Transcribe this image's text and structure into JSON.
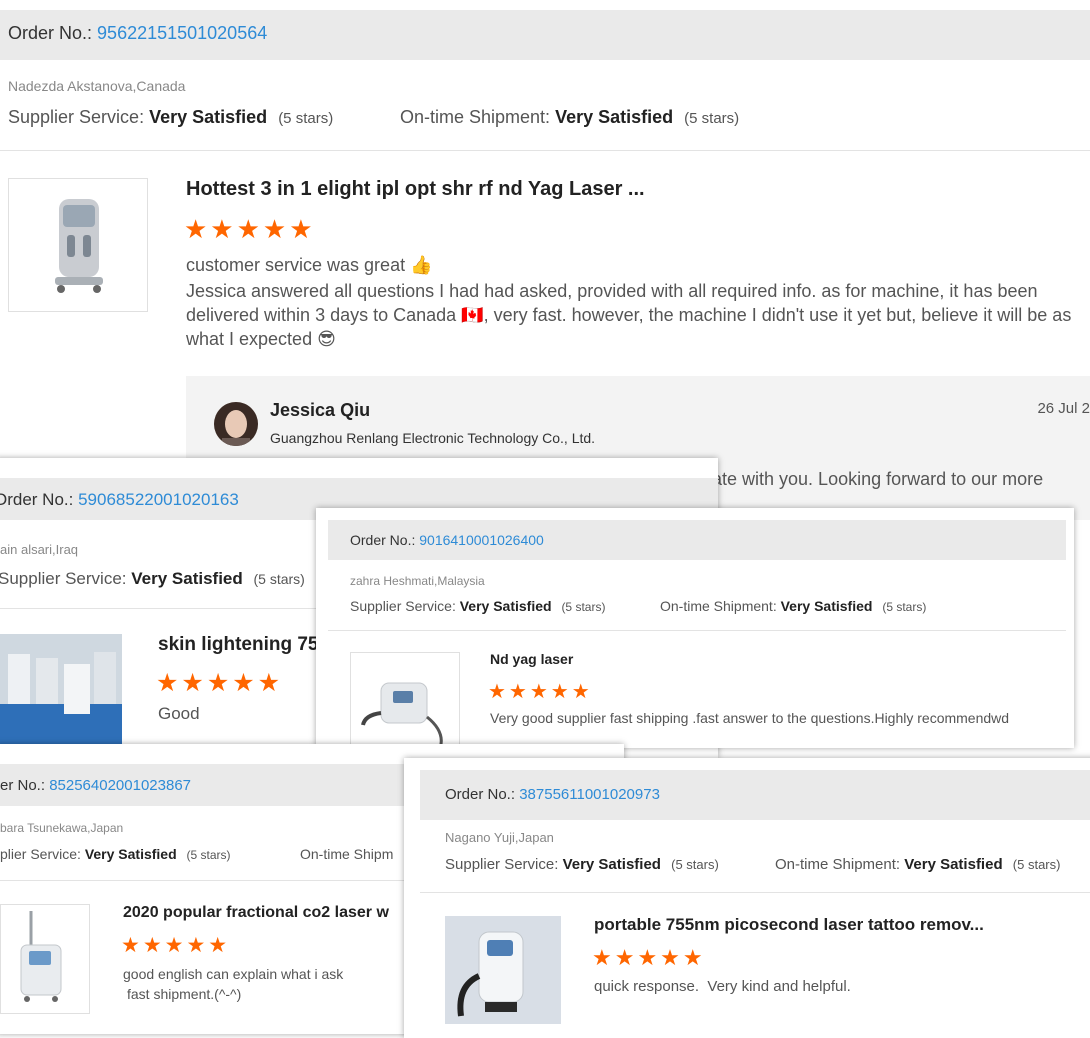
{
  "review1": {
    "order_label": "Order No.:",
    "order_no": "95622151501020564",
    "buyer": "Nadezda Akstanova,Canada",
    "supplier_service_label": "Supplier Service:",
    "supplier_service_value": "Very Satisfied",
    "supplier_service_stars": "(5 stars)",
    "shipment_label": "On-time Shipment:",
    "shipment_value": "Very Satisfied",
    "shipment_stars": "(5 stars)",
    "product_title": "Hottest 3 in 1 elight ipl opt shr rf nd Yag Laser ...",
    "rating_stars": "★★★★★",
    "review_line1": "customer service was great 👍",
    "review_line2": "Jessica answered all questions I had had asked, provided with all required info. as for machine, it has been delivered within 3 days to Canada 🇨🇦, very fast. however, the machine I didn't use it yet but, believe it will be as what I expected 😎",
    "reply_name": "Jessica Qiu",
    "reply_company": "Guangzhou Renlang Electronic Technology Co., Ltd.",
    "reply_date": "26 Jul 2",
    "reply_text_fragment": "rate with you. Looking forward to our more"
  },
  "review2": {
    "order_label": "Order No.:",
    "order_no": "59068522001020163",
    "buyer": "ain alsari,Iraq",
    "supplier_service_label": "Supplier Service:",
    "supplier_service_value": "Very Satisfied",
    "supplier_service_stars": "(5 stars)",
    "product_title": "skin lightening 75",
    "rating_stars": "★★★★★",
    "review_text": "Good"
  },
  "review3": {
    "order_label": "Order No.:",
    "order_no": "9016410001026400",
    "buyer": "zahra Heshmati,Malaysia",
    "supplier_service_label": "Supplier Service:",
    "supplier_service_value": "Very Satisfied",
    "supplier_service_stars": "(5 stars)",
    "shipment_label": "On-time Shipment:",
    "shipment_value": "Very Satisfied",
    "shipment_stars": "(5 stars)",
    "product_title": "Nd yag laser",
    "rating_stars": "★★★★★",
    "review_text": "Very good supplier fast shipping .fast answer to the questions.Highly recommendwd"
  },
  "review4": {
    "order_label": "er No.:",
    "order_no": "85256402001023867",
    "buyer": "bara Tsunekawa,Japan",
    "supplier_service_label": "plier Service:",
    "supplier_service_value": "Very Satisfied",
    "supplier_service_stars": "(5 stars)",
    "shipment_label": "On-time Shipm",
    "product_title": "2020 popular fractional co2 laser w",
    "rating_stars": "★★★★★",
    "review_line1": "good english can explain what i ask",
    "review_line2": "fast shipment.(^-^)"
  },
  "review5": {
    "order_label": "Order No.:",
    "order_no": "38755611001020973",
    "buyer": "Nagano Yuji,Japan",
    "supplier_service_label": "Supplier Service:",
    "supplier_service_value": "Very Satisfied",
    "supplier_service_stars": "(5 stars)",
    "shipment_label": "On-time Shipment:",
    "shipment_value": "Very Satisfied",
    "shipment_stars": "(5 stars)",
    "product_title": "portable 755nm picosecond laser tattoo remov...",
    "rating_stars": "★★★★★",
    "review_text": "quick response.  Very kind and helpful."
  },
  "colors": {
    "order_number": "#2e8bd6",
    "stars": "#ff6600",
    "order_bar": "#eaeaea"
  }
}
